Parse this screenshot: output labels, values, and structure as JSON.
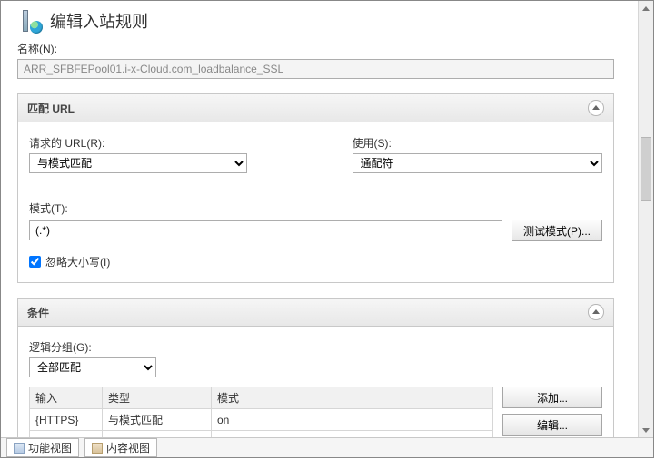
{
  "header": {
    "title": "编辑入站规则"
  },
  "name": {
    "label": "名称(N):",
    "value": "ARR_SFBFEPool01.i-x-Cloud.com_loadbalance_SSL"
  },
  "match_url": {
    "panel_title": "匹配 URL",
    "req_url_label": "请求的 URL(R):",
    "req_url_value": "与模式匹配",
    "use_label": "使用(S):",
    "use_value": "通配符",
    "pattern_label": "模式(T):",
    "pattern_value": "(.*)",
    "test_btn": "测试模式(P)...",
    "ignore_case_label": "忽略大小写(I)",
    "ignore_case_checked": true
  },
  "conditions": {
    "panel_title": "条件",
    "group_label": "逻辑分组(G):",
    "group_value": "全部匹配",
    "columns": {
      "input": "输入",
      "type": "类型",
      "pattern": "模式"
    },
    "rows": [
      {
        "input": "{HTTPS}",
        "type": "与模式匹配",
        "pattern": "on"
      }
    ],
    "buttons": {
      "add": "添加...",
      "edit": "编辑..."
    }
  },
  "footer": {
    "feature_view": "功能视图",
    "content_view": "内容视图"
  }
}
